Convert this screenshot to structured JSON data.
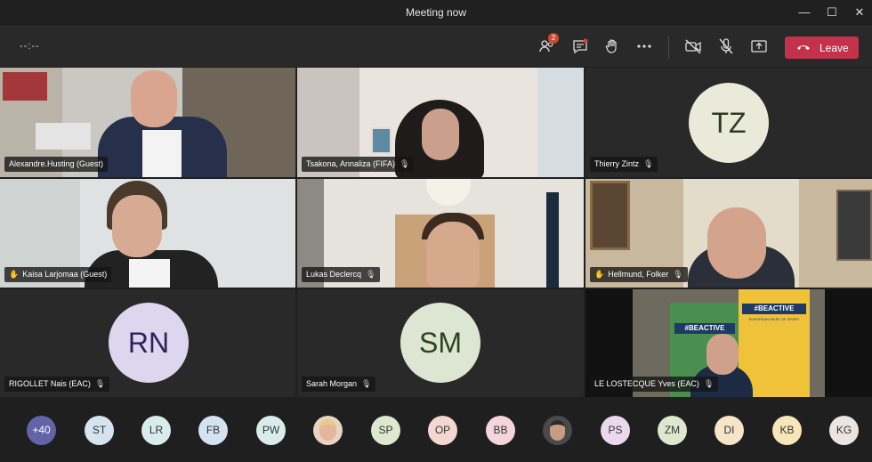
{
  "window": {
    "title": "Meeting now"
  },
  "toolbar": {
    "timer": "--:--",
    "participants_badge": "2",
    "leave_label": "Leave"
  },
  "tiles": {
    "t1": {
      "name": "Alexandre.Husting (Guest)"
    },
    "t2": {
      "name": "Tsakona, Annaliza (FIFA)"
    },
    "t3": {
      "name": "Thierry Zintz",
      "initials": "TZ"
    },
    "t4": {
      "name": "Kaisa Larjomaa (Guest)"
    },
    "t5": {
      "name": "Lukas Declercq"
    },
    "t6": {
      "name": "Hellmund, Folker"
    },
    "t7": {
      "name": "RIGOLLET Nais (EAC)",
      "initials": "RN"
    },
    "t8": {
      "name": "Sarah Morgan",
      "initials": "SM"
    },
    "t9": {
      "name": "LE LOSTECQUE Yves (EAC)",
      "banner1": "#BEACTIVE",
      "banner2": "#BEACTIVE",
      "banner2_sub": "EUROPEAN WEEK OF SPORT"
    }
  },
  "strip": {
    "more": "+40",
    "p1": "ST",
    "p2": "LR",
    "p3": "FB",
    "p4": "PW",
    "p6": "SP",
    "p7": "OP",
    "p8": "BB",
    "p10": "PS",
    "p11": "ZM",
    "p12": "DI",
    "p13": "KB",
    "p14": "KG"
  },
  "colors": {
    "leave": "#c4314b",
    "tz_bg": "#e9ead9",
    "rn_bg": "#dcd6ef",
    "sm_bg": "#dde6d2"
  }
}
